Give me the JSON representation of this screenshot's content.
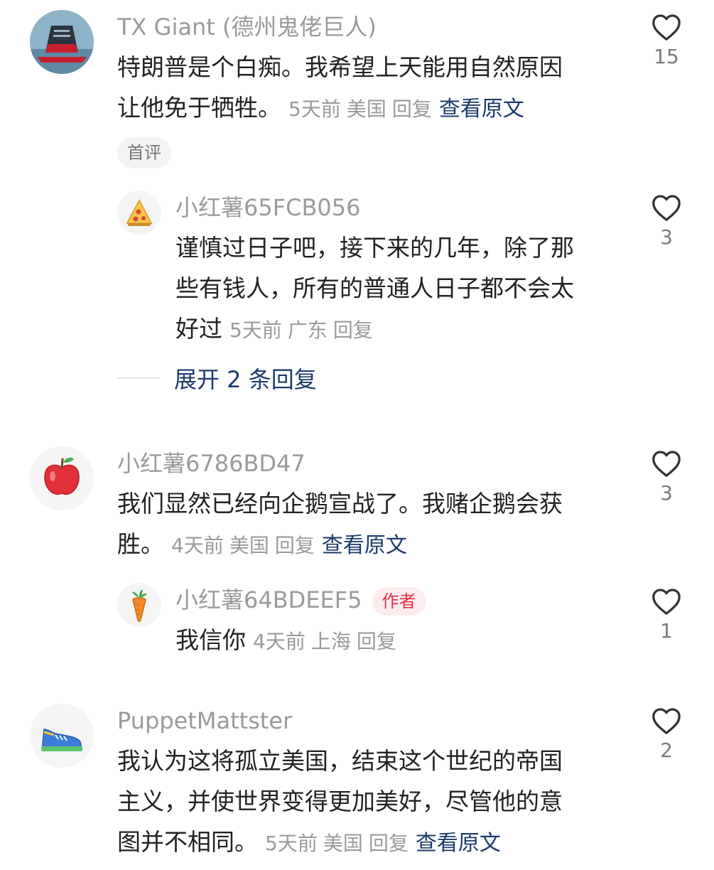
{
  "comments": [
    {
      "name": "TX Giant (德州鬼佬巨人)",
      "avatar_icon": "cruise-ship-avatar",
      "lines": [
        "特朗普是个白痴。我希望上天能用自然原因",
        "让他免于牺牲。"
      ],
      "time": "5天前",
      "location": "美国",
      "reply": "回复",
      "translate": "查看原文",
      "likes": "15",
      "tag": "首评"
    },
    {
      "name": "小红薯65FCB056",
      "avatar_icon": "pizza-avatar",
      "lines": [
        "谨慎过日子吧，接下来的几年，除了那",
        "些有钱人，所有的普通人日子都不会太",
        "好过"
      ],
      "time": "5天前",
      "location": "广东",
      "reply": "回复",
      "likes": "3",
      "expand": "展开 2 条回复"
    },
    {
      "name": "小红薯6786BD47",
      "avatar_icon": "apple-avatar",
      "lines": [
        "我们显然已经向企鹅宣战了。我赌企鹅会获",
        "胜。"
      ],
      "time": "4天前",
      "location": "美国",
      "reply": "回复",
      "translate": "查看原文",
      "likes": "3"
    },
    {
      "name": "小红薯64BDEEF5",
      "avatar_icon": "carrot-avatar",
      "badge": "作者",
      "lines": [
        "我信你"
      ],
      "time": "4天前",
      "location": "上海",
      "reply": "回复",
      "likes": "1"
    },
    {
      "name": "PuppetMattster",
      "avatar_icon": "sneaker-avatar",
      "lines": [
        "我认为这将孤立美国，结束这个世纪的帝国",
        "主义，并使世界变得更加美好，尽管他的意",
        "图并不相同。"
      ],
      "time": "5天前",
      "location": "美国",
      "reply": "回复",
      "translate": "查看原文",
      "likes": "2"
    }
  ],
  "colors": {
    "name": "#9a9a9a",
    "text": "#222222",
    "link": "#1b3b6b",
    "badge_bg": "#fdecee",
    "badge_text": "#e0334c"
  }
}
